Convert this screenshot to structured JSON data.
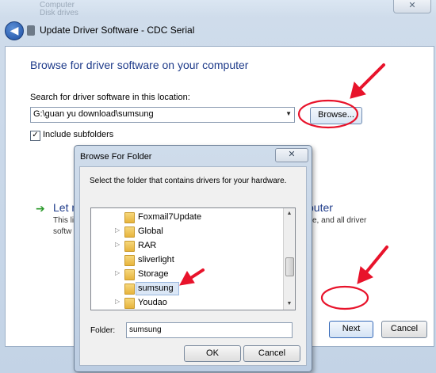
{
  "background_window": {
    "items": [
      "Computer",
      "Disk drives"
    ],
    "close_glyph": "✕"
  },
  "wizard": {
    "back_glyph": "◀",
    "title": "Update Driver Software - CDC Serial",
    "heading": "Browse for driver software on your computer",
    "search_label": "Search for driver software in this location:",
    "path_value": "G:\\guan yu download\\sumsung",
    "combo_arrow": "▼",
    "browse_label": "Browse...",
    "include_subfolders_label": "Include subfolders",
    "include_subfolders_checked": true,
    "check_glyph": "✓",
    "arrow_glyph": "➔",
    "letme_fragment": "Let m",
    "letme_right_fragment": "puter",
    "desc_line1_fragment": "This li",
    "desc_line2_fragment": "softw",
    "desc_right_fragment": "e, and all driver",
    "next_label": "Next",
    "cancel_label": "Cancel"
  },
  "folder_dialog": {
    "title": "Browse For Folder",
    "close_glyph": "✕",
    "instruction": "Select the folder that contains drivers for your hardware.",
    "tree": [
      {
        "label": "Foxmail7Update",
        "expander": ""
      },
      {
        "label": "Global",
        "expander": "▷"
      },
      {
        "label": "RAR",
        "expander": "▷"
      },
      {
        "label": "sliverlight",
        "expander": ""
      },
      {
        "label": "Storage",
        "expander": "▷"
      },
      {
        "label": "sumsung",
        "expander": "",
        "selected": true
      },
      {
        "label": "Youdao",
        "expander": "▷"
      }
    ],
    "scroll_up_glyph": "▲",
    "scroll_down_glyph": "▼",
    "folder_label": "Folder:",
    "folder_value": "sumsung",
    "ok_label": "OK",
    "cancel_label": "Cancel"
  },
  "colors": {
    "annotation": "#e8132b",
    "heading": "#1e3b8a",
    "selection": "#dbe7f6"
  }
}
